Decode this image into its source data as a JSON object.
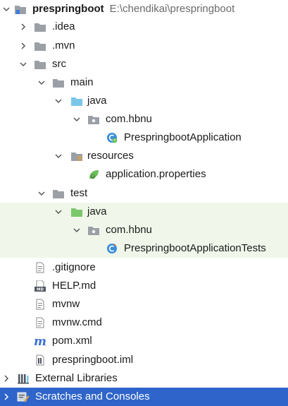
{
  "project": {
    "name": "prespringboot",
    "path": "E:\\chendikai\\prespringboot"
  },
  "tree": {
    "idea": ".idea",
    "mvn": ".mvn",
    "src": "src",
    "main": "main",
    "main_java": "java",
    "main_pkg": "com.hbnu",
    "app_class": "PrespringbootApplication",
    "resources": "resources",
    "app_props": "application.properties",
    "test": "test",
    "test_java": "java",
    "test_pkg": "com.hbnu",
    "test_class": "PrespringbootApplicationTests",
    "gitignore": ".gitignore",
    "help": "HELP.md",
    "mvnw": "mvnw",
    "mvnw_cmd": "mvnw.cmd",
    "pom": "pom.xml",
    "iml": "prespringboot.iml",
    "external_libraries": "External Libraries",
    "scratches": "Scratches and Consoles"
  },
  "icons": {
    "folder": "folder-icon",
    "source_folder": "source-folder-icon",
    "test_folder": "test-source-folder-icon",
    "resources_folder": "resources-folder-icon",
    "package": "package-icon",
    "spring_class": "spring-boot-class-icon",
    "spring_props": "spring-properties-icon",
    "maven": "maven-icon",
    "markdown": "markdown-icon",
    "text_file": "file-icon"
  },
  "colors": {
    "selection": "#2f65ca",
    "test_highlight": "#f0f7ea",
    "folder_gray": "#9aa0a6",
    "source_blue": "#7cc6e8",
    "test_green": "#7bc86c",
    "maven_blue": "#3b6ed8",
    "path_gray": "#6b6b6b"
  }
}
